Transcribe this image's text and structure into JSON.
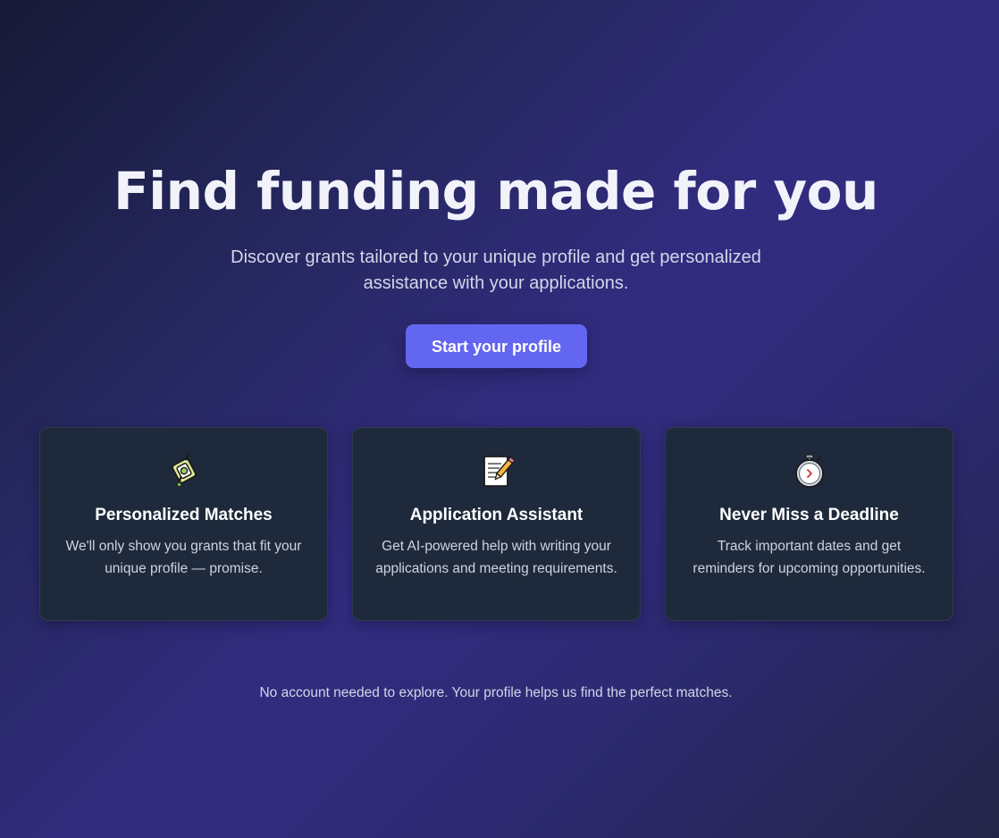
{
  "hero": {
    "title": "Find funding made for you",
    "subtitle": "Discover grants tailored to your unique profile and get personalized assistance with your applications.",
    "cta_label": "Start your profile"
  },
  "features": [
    {
      "icon": "target-match-icon",
      "title": "Personalized Matches",
      "description": "We'll only show you grants that fit your unique profile — promise."
    },
    {
      "icon": "memo-pencil-icon",
      "title": "Application Assistant",
      "description": "Get AI-powered help with writing your applications and meeting requirements."
    },
    {
      "icon": "stopwatch-icon",
      "title": "Never Miss a Deadline",
      "description": "Track important dates and get reminders for upcoming opportunities."
    }
  ],
  "footer": {
    "note": "No account needed to explore. Your profile helps us find the perfect matches."
  },
  "colors": {
    "accent": "#6366f1",
    "card_background": "#1e2a3b",
    "background_dark": "#161a36",
    "background_mid": "#322c80"
  }
}
